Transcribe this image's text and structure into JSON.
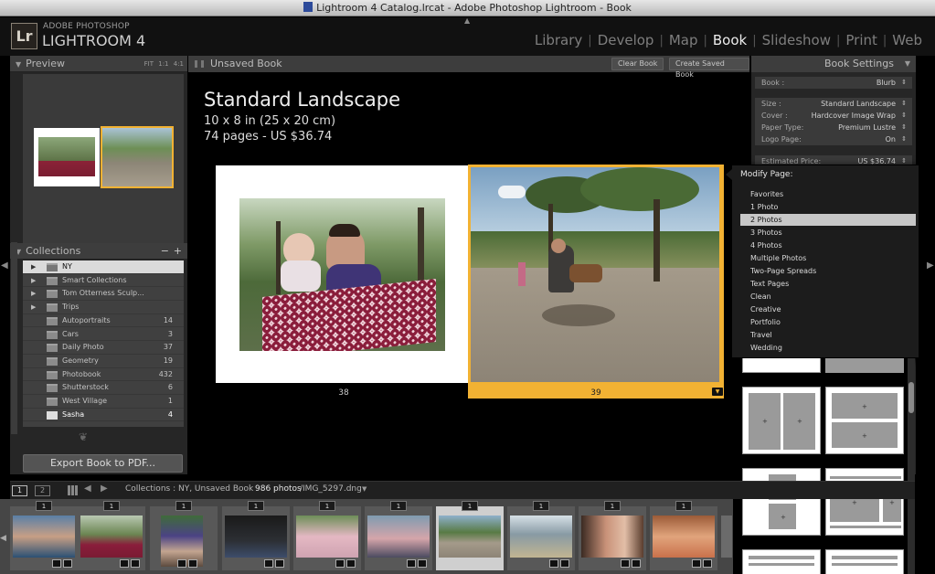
{
  "window_title": "Lightroom 4 Catalog.lrcat - Adobe Photoshop Lightroom - Book",
  "brand": {
    "logo": "Lr",
    "vendor": "ADOBE PHOTOSHOP",
    "product": "LIGHTROOM 4"
  },
  "modules": [
    "Library",
    "Develop",
    "Map",
    "Book",
    "Slideshow",
    "Print",
    "Web"
  ],
  "active_module": "Book",
  "preview": {
    "title": "Preview",
    "zoom_options": [
      "FIT",
      "1:1",
      "4:1"
    ]
  },
  "collections": {
    "title": "Collections",
    "minus": "−",
    "plus": "+",
    "items": [
      {
        "name": "NY",
        "count": ""
      },
      {
        "name": "Smart Collections",
        "count": ""
      },
      {
        "name": "Tom Otterness Sculp...",
        "count": ""
      },
      {
        "name": "Trips",
        "count": ""
      },
      {
        "name": "Autoportraits",
        "count": "14"
      },
      {
        "name": "Cars",
        "count": "3"
      },
      {
        "name": "Daily Photo",
        "count": "37"
      },
      {
        "name": "Geometry",
        "count": "19"
      },
      {
        "name": "Photobook",
        "count": "432"
      },
      {
        "name": "Shutterstock",
        "count": "6"
      },
      {
        "name": "West Village",
        "count": "1"
      },
      {
        "name": "Sasha",
        "count": "4"
      }
    ]
  },
  "export_button": "Export Book to PDF...",
  "book": {
    "tab_title": "Unsaved Book",
    "clear_button": "Clear Book",
    "save_button": "Create Saved Book",
    "title": "Standard Landscape",
    "size_line": "10 x 8 in (25 x 20 cm)",
    "pages_line": "74 pages - US $36.74",
    "left_page_number": "38",
    "right_page_number": "39"
  },
  "book_settings": {
    "title": "Book Settings",
    "rows": [
      {
        "key": "Book :",
        "value": "Blurb"
      },
      {
        "key": "Size :",
        "value": "Standard Landscape"
      },
      {
        "key": "Cover :",
        "value": "Hardcover Image Wrap"
      },
      {
        "key": "Paper Type:",
        "value": "Premium Lustre"
      },
      {
        "key": "Logo Page:",
        "value": "On"
      },
      {
        "key": "Estimated Price:",
        "value": "US $36.74"
      }
    ]
  },
  "modify_menu": {
    "title": "Modify Page:",
    "selected": "2 Photos",
    "items": [
      "Favorites",
      "1 Photo",
      "2 Photos",
      "3 Photos",
      "4 Photos",
      "Multiple Photos",
      "Two-Page Spreads",
      "Text Pages",
      "Clean",
      "Creative",
      "Portfolio",
      "Travel",
      "Wedding"
    ]
  },
  "filmbar": {
    "page1": "1",
    "page2": "2",
    "source": "Collections : NY, Unsaved Book",
    "count": "986 photos",
    "filename": "/IMG_5297.dng"
  },
  "filmstrip": {
    "use_counts": [
      "1",
      "1",
      "1",
      "1",
      "1",
      "1",
      "1",
      "1",
      "1",
      "1"
    ],
    "selected_index": 6
  },
  "colors": {
    "accent": "#f2b233",
    "panel": "#262626",
    "header": "#3d3d3d",
    "selected_menu": "#c7c7c7"
  }
}
